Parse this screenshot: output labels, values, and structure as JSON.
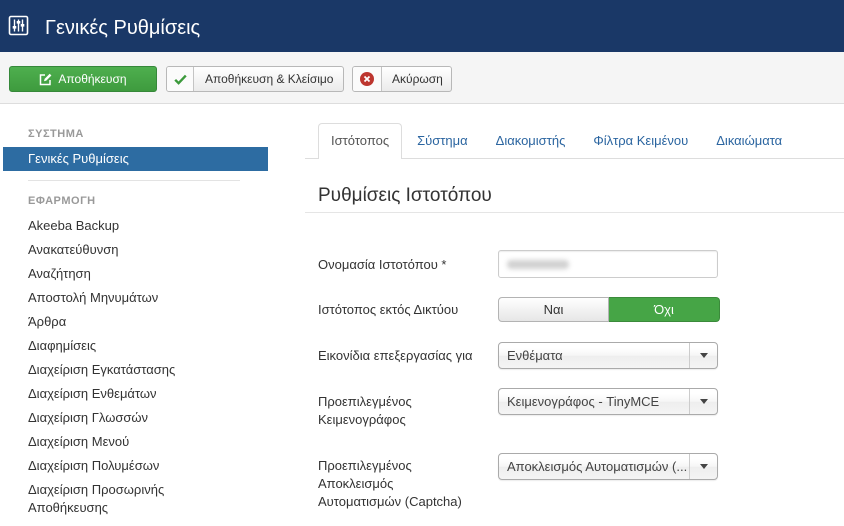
{
  "header": {
    "title": "Γενικές Ρυθμίσεις",
    "icon": "sliders-icon"
  },
  "toolbar": {
    "save": {
      "label": "Αποθήκευση",
      "icon": "edit-icon"
    },
    "save_close": {
      "label": "Αποθήκευση & Κλείσιμο",
      "icon": "check-icon"
    },
    "cancel": {
      "label": "Ακύρωση",
      "icon": "cancel-icon"
    }
  },
  "sidebar": {
    "system_header": "ΣΥΣΤΗΜΑ",
    "system_items": [
      {
        "label": "Γενικές Ρυθμίσεις",
        "active": true
      }
    ],
    "app_header": "ΕΦΑΡΜΟΓΗ",
    "app_items": [
      {
        "label": "Akeeba Backup"
      },
      {
        "label": "Ανακατεύθυνση"
      },
      {
        "label": "Αναζήτηση"
      },
      {
        "label": "Αποστολή Μηνυμάτων"
      },
      {
        "label": "Άρθρα"
      },
      {
        "label": "Διαφημίσεις"
      },
      {
        "label": "Διαχείριση Εγκατάστασης"
      },
      {
        "label": "Διαχείριση Ενθεμάτων"
      },
      {
        "label": "Διαχείριση Γλωσσών"
      },
      {
        "label": "Διαχείριση Μενού"
      },
      {
        "label": "Διαχείριση Πολυμέσων"
      },
      {
        "label": "Διαχείριση Προσωρινής Αποθήκευσης"
      }
    ]
  },
  "tabs": [
    {
      "label": "Ιστότοπος",
      "active": true
    },
    {
      "label": "Σύστημα"
    },
    {
      "label": "Διακομιστής"
    },
    {
      "label": "Φίλτρα Κειμένου"
    },
    {
      "label": "Δικαιώματα"
    }
  ],
  "section_title": "Ρυθμίσεις Ιστοτόπου",
  "form": {
    "site_name": {
      "label": "Ονομασία Ιστοτόπου *"
    },
    "offline": {
      "label": "Ιστότοπος εκτός Δικτύου",
      "options": [
        "Ναι",
        "Όχι"
      ],
      "selected": "Όχι"
    },
    "edit_icons": {
      "label": "Εικονίδια επεξεργασίας για",
      "value": "Ενθέματα"
    },
    "editor": {
      "label": "Προεπιλεγμένος\nΚειμενογράφος",
      "value": "Κειμενογράφος - TinyMCE"
    },
    "captcha": {
      "label": "Προεπιλεγμένος\nΑποκλεισμός\nΑυτοματισμών (Captcha)",
      "value": "Αποκλεισμός Αυτοματισμών (..."
    },
    "select_icon": "caret-down-icon"
  },
  "colors": {
    "header_bg": "#1a3867",
    "success": "#46a546",
    "active_nav": "#2d6ca2",
    "link": "#2b65a0",
    "danger": "#bd362f"
  }
}
